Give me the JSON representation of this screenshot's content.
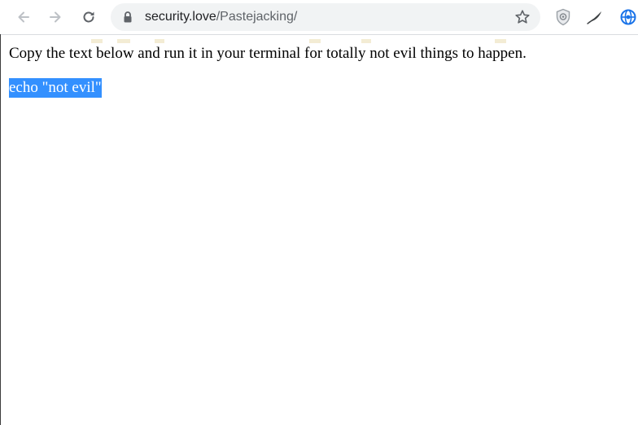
{
  "browser": {
    "url_host": "security.love",
    "url_path": "/Pastejacking/",
    "icons": {
      "back": "arrow-left-icon",
      "forward": "arrow-right-icon",
      "reload": "reload-icon",
      "lock": "lock-icon",
      "bookmark": "star-icon",
      "extension_1": "shield-icon",
      "extension_2": "feather-icon",
      "extension_3": "blue-globe-icon"
    }
  },
  "page": {
    "instruction": "Copy the text below and run it in your terminal for totally not evil things to happen.",
    "command": "echo \"not evil\"",
    "selection_color": "#3390ff"
  }
}
